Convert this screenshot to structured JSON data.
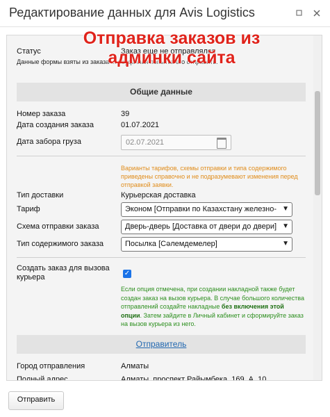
{
  "window": {
    "title": "Редактирование данных для Avis Logistics",
    "minimize_icon": "minimize-icon",
    "close_icon": "close-icon"
  },
  "overlay_caption": "Отправка заказов из админки сайта",
  "status": {
    "label": "Статус",
    "value": "Заказ еще не отправлялся",
    "note": "Данные формы взяты из заказа ... неудачная попытка его отправить."
  },
  "general": {
    "section_title": "Общие данные",
    "order_number_label": "Номер заказа",
    "order_number": "39",
    "created_label": "Дата создания заказа",
    "created_value": "01.07.2021",
    "pickup_label": "Дата забора груза",
    "pickup_value": "02.07.2021"
  },
  "tariff_notice": "Варианты тарифов, схемы отправки и типа содержимого приведены справочно и не подразумевают изменения перед отправкой заявки.",
  "delivery": {
    "type_label": "Тип доставки",
    "type_value": "Курьерская доставка",
    "tariff_label": "Тариф",
    "tariff_value": "Эконом [Отправки по Казахстану железно-дорожным транспортом]",
    "scheme_label": "Схема отправки заказа",
    "scheme_value": "Дверь-дверь [Доставка от двери до двери]",
    "content_label": "Тип содержимого заказа",
    "content_value": "Посылка [Сәлемдемелер]"
  },
  "courier": {
    "label": "Создать заказ для вызова курьера",
    "checked": true,
    "note_1": "Если опция отмечена, при создании накладной также будет создан заказ на вызов курьера. В случае большого количества отправлений создайте накладные",
    "note_bold": "без включения этой опции",
    "note_2": ". Затем зайдите в Личный кабинет и сформируйте заказ на вызов курьера из него."
  },
  "sender": {
    "section_link": "Отправитель",
    "city_label": "Город отправления",
    "city_value": "Алматы",
    "address_label": "Полный адрес",
    "address_value": "Алматы, проспект Райымбека, 169, А, 10"
  },
  "footer": {
    "submit_label": "Отправить"
  }
}
